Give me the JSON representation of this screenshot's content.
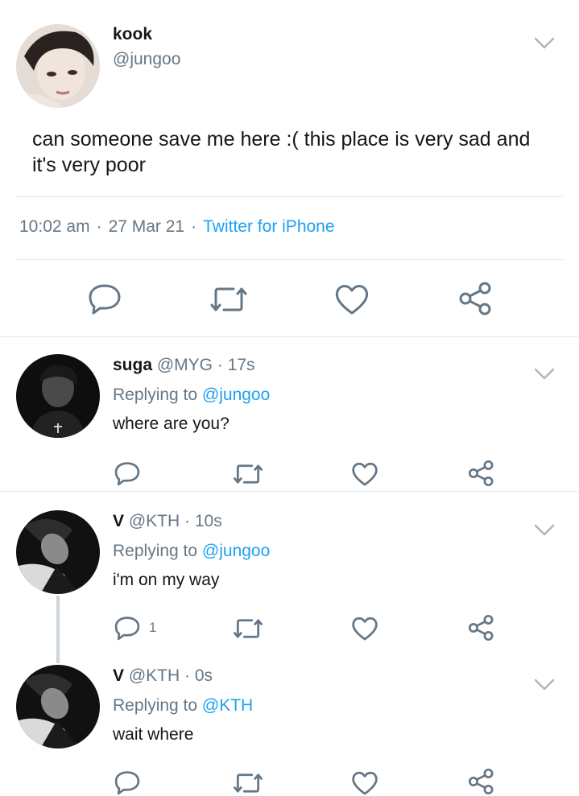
{
  "main_tweet": {
    "name": "kook",
    "handle": "@jungoo",
    "text": "can someone save me here :( this place is very sad and it's very poor",
    "time": "10:02 am",
    "date": "27 Mar 21",
    "separator": "·",
    "source": "Twitter for iPhone"
  },
  "replies": [
    {
      "name": "suga",
      "handle": "@MYG",
      "time": "· 17s",
      "replying_prefix": "Replying to",
      "replying_to": "@jungoo",
      "text": "where are you?",
      "reply_count": ""
    },
    {
      "name": "V",
      "handle": "@KTH",
      "time": "· 10s",
      "replying_prefix": "Replying to",
      "replying_to": "@jungoo",
      "text": "i'm on my way",
      "reply_count": "1"
    },
    {
      "name": "V",
      "handle": "@KTH",
      "time": "· 0s",
      "replying_prefix": "Replying to",
      "replying_to": "@KTH",
      "text": "wait where",
      "reply_count": ""
    }
  ],
  "icons": {
    "reply": "reply-icon",
    "retweet": "retweet-icon",
    "like": "heart-icon",
    "share": "share-icon",
    "more": "chevron-down-icon"
  },
  "colors": {
    "link": "#1da1f2",
    "secondary_text": "#657786",
    "primary_text": "#14171a",
    "icon": "#657786",
    "divider": "#e1e8ed"
  }
}
